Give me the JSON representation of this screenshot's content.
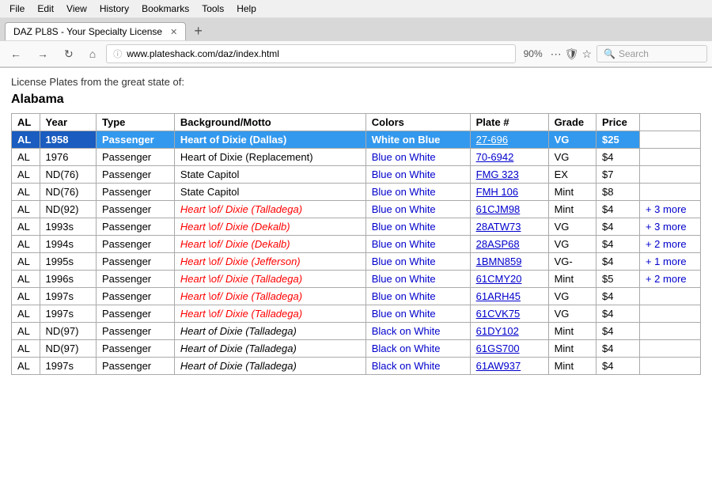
{
  "browser": {
    "menu": [
      "File",
      "Edit",
      "View",
      "History",
      "Bookmarks",
      "Tools",
      "Help"
    ],
    "tab_title": "DAZ PL8S - Your Specialty License",
    "url": "www.plateshack.com/daz/index.html",
    "zoom": "90%",
    "search_placeholder": "Search"
  },
  "page": {
    "intro": "License Plates from the great state of:",
    "state": "Alabama",
    "table_headers": [
      "AL",
      "Year",
      "Type",
      "Background/Motto",
      "Colors",
      "Plate #",
      "Grade",
      "Price"
    ],
    "rows": [
      {
        "al": "AL",
        "year": "1958",
        "type": "Passenger",
        "bg": "Heart of Dixie (Dallas)",
        "colors": "White on Blue",
        "plate": "27-696",
        "grade": "VG",
        "price": "$25",
        "selected": true,
        "bg_red": false,
        "more": ""
      },
      {
        "al": "AL",
        "year": "1976",
        "type": "Passenger",
        "bg": "Heart of Dixie (Replacement)",
        "colors": "Blue on White",
        "plate": "70-6942",
        "grade": "VG",
        "price": "$4",
        "selected": false,
        "bg_red": false,
        "more": ""
      },
      {
        "al": "AL",
        "year": "ND(76)",
        "type": "Passenger",
        "bg": "State Capitol",
        "colors": "Blue on White",
        "plate": "FMG 323",
        "grade": "EX",
        "price": "$7",
        "selected": false,
        "bg_red": false,
        "more": ""
      },
      {
        "al": "AL",
        "year": "ND(76)",
        "type": "Passenger",
        "bg": "State Capitol",
        "colors": "Blue on White",
        "plate": "FMH 106",
        "grade": "Mint",
        "price": "$8",
        "selected": false,
        "bg_red": false,
        "more": ""
      },
      {
        "al": "AL",
        "year": "ND(92)",
        "type": "Passenger",
        "bg": "Heart \\of/ Dixie (Talladega)",
        "colors": "Blue on White",
        "plate": "61CJM98",
        "grade": "Mint",
        "price": "$4",
        "selected": false,
        "bg_red": true,
        "more": "+ 3 more"
      },
      {
        "al": "AL",
        "year": "1993s",
        "type": "Passenger",
        "bg": "Heart \\of/ Dixie (Dekalb)",
        "colors": "Blue on White",
        "plate": "28ATW73",
        "grade": "VG",
        "price": "$4",
        "selected": false,
        "bg_red": true,
        "more": "+ 3 more"
      },
      {
        "al": "AL",
        "year": "1994s",
        "type": "Passenger",
        "bg": "Heart \\of/ Dixie (Dekalb)",
        "colors": "Blue on White",
        "plate": "28ASP68",
        "grade": "VG",
        "price": "$4",
        "selected": false,
        "bg_red": true,
        "more": "+ 2 more"
      },
      {
        "al": "AL",
        "year": "1995s",
        "type": "Passenger",
        "bg": "Heart \\of/ Dixie (Jefferson)",
        "colors": "Blue on White",
        "plate": "1BMN859",
        "grade": "VG-",
        "price": "$4",
        "selected": false,
        "bg_red": true,
        "more": "+ 1 more"
      },
      {
        "al": "AL",
        "year": "1996s",
        "type": "Passenger",
        "bg": "Heart \\of/ Dixie (Talladega)",
        "colors": "Blue on White",
        "plate": "61CMY20",
        "grade": "Mint",
        "price": "$5",
        "selected": false,
        "bg_red": true,
        "more": "+ 2 more"
      },
      {
        "al": "AL",
        "year": "1997s",
        "type": "Passenger",
        "bg": "Heart \\of/ Dixie (Talladega)",
        "colors": "Blue on White",
        "plate": "61ARH45",
        "grade": "VG",
        "price": "$4",
        "selected": false,
        "bg_red": true,
        "more": ""
      },
      {
        "al": "AL",
        "year": "1997s",
        "type": "Passenger",
        "bg": "Heart \\of/ Dixie (Talladega)",
        "colors": "Blue on White",
        "plate": "61CVK75",
        "grade": "VG",
        "price": "$4",
        "selected": false,
        "bg_red": true,
        "more": ""
      },
      {
        "al": "AL",
        "year": "ND(97)",
        "type": "Passenger",
        "bg": "Heart of Dixie (Talladega)",
        "colors": "Black on White",
        "plate": "61DY102",
        "grade": "Mint",
        "price": "$4",
        "selected": false,
        "bg_red": false,
        "bg_italic": true,
        "more": ""
      },
      {
        "al": "AL",
        "year": "ND(97)",
        "type": "Passenger",
        "bg": "Heart of Dixie (Talladega)",
        "colors": "Black on White",
        "plate": "61GS700",
        "grade": "Mint",
        "price": "$4",
        "selected": false,
        "bg_red": false,
        "bg_italic": true,
        "more": ""
      },
      {
        "al": "AL",
        "year": "1997s",
        "type": "Passenger",
        "bg": "Heart of Dixie (Talladega)",
        "colors": "Black on White",
        "plate": "61AW937",
        "grade": "Mint",
        "price": "$4",
        "selected": false,
        "bg_red": false,
        "bg_italic": true,
        "more": ""
      }
    ]
  }
}
